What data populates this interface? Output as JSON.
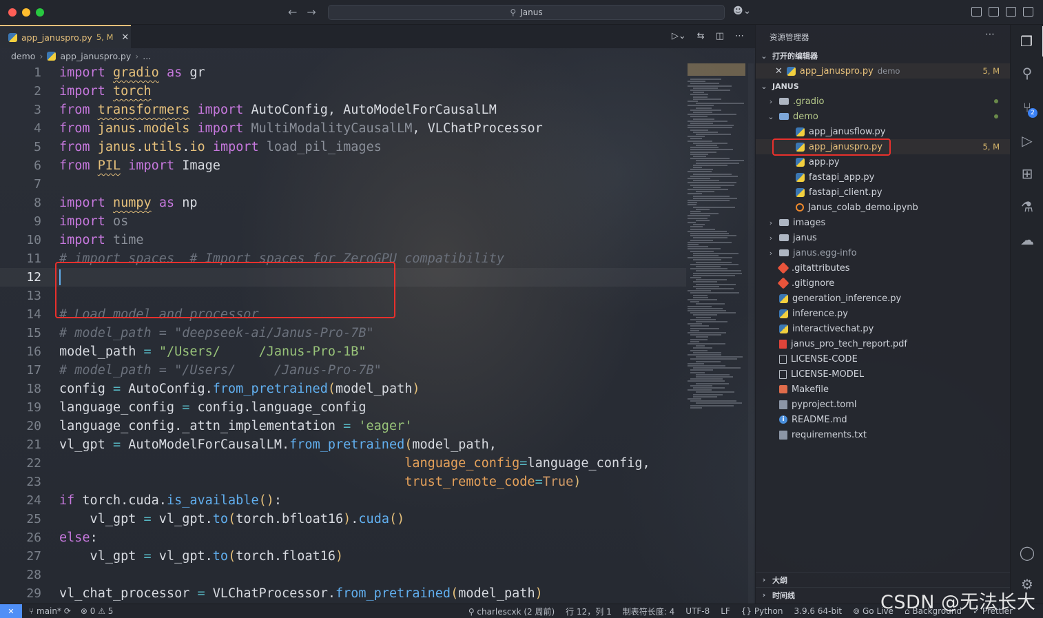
{
  "window": {
    "search_text": "Janus"
  },
  "tab": {
    "filename": "app_januspro.py",
    "status": "5, M"
  },
  "breadcrumb": [
    "demo",
    "app_januspro.py",
    "..."
  ],
  "code": [
    {
      "n": "1",
      "segs": [
        [
          "kw",
          "import"
        ],
        [
          "plain",
          " "
        ],
        [
          "mod-n",
          "gradio"
        ],
        [
          "plain",
          " "
        ],
        [
          "kw",
          "as"
        ],
        [
          "plain",
          " gr"
        ]
      ]
    },
    {
      "n": "2",
      "segs": [
        [
          "kw",
          "import"
        ],
        [
          "plain",
          " "
        ],
        [
          "mod-n",
          "torch"
        ]
      ]
    },
    {
      "n": "3",
      "segs": [
        [
          "kw",
          "from"
        ],
        [
          "plain",
          " "
        ],
        [
          "mod-n",
          "transformers"
        ],
        [
          "plain",
          " "
        ],
        [
          "kw",
          "import"
        ],
        [
          "plain",
          " AutoConfig, AutoModelForCausalLM"
        ]
      ]
    },
    {
      "n": "4",
      "segs": [
        [
          "kw",
          "from"
        ],
        [
          "plain",
          " "
        ],
        [
          "mod-p",
          "janus"
        ],
        [
          "plain",
          "."
        ],
        [
          "mod-p",
          "models"
        ],
        [
          "plain",
          " "
        ],
        [
          "kw",
          "import"
        ],
        [
          "dim",
          " MultiModalityCausalLM"
        ],
        [
          "plain",
          ", VLChatProcessor"
        ]
      ]
    },
    {
      "n": "5",
      "segs": [
        [
          "kw",
          "from"
        ],
        [
          "plain",
          " "
        ],
        [
          "mod-p",
          "janus"
        ],
        [
          "plain",
          "."
        ],
        [
          "mod-p",
          "utils"
        ],
        [
          "plain",
          "."
        ],
        [
          "mod-p",
          "io"
        ],
        [
          "plain",
          " "
        ],
        [
          "kw",
          "import"
        ],
        [
          "dim",
          " load_pil_images"
        ]
      ]
    },
    {
      "n": "6",
      "segs": [
        [
          "kw",
          "from"
        ],
        [
          "plain",
          " "
        ],
        [
          "mod-n",
          "PIL"
        ],
        [
          "plain",
          " "
        ],
        [
          "kw",
          "import"
        ],
        [
          "plain",
          " Image"
        ]
      ]
    },
    {
      "n": "7",
      "segs": []
    },
    {
      "n": "8",
      "segs": [
        [
          "kw",
          "import"
        ],
        [
          "plain",
          " "
        ],
        [
          "mod-n",
          "numpy"
        ],
        [
          "plain",
          " "
        ],
        [
          "kw",
          "as"
        ],
        [
          "plain",
          " np"
        ]
      ]
    },
    {
      "n": "9",
      "segs": [
        [
          "kw",
          "import"
        ],
        [
          "dim",
          " os"
        ]
      ]
    },
    {
      "n": "10",
      "segs": [
        [
          "kw",
          "import"
        ],
        [
          "dim",
          " time"
        ]
      ]
    },
    {
      "n": "11",
      "segs": [
        [
          "cmt",
          "# import spaces  # Import spaces for ZeroGPU compatibility"
        ]
      ]
    },
    {
      "n": "12",
      "segs": []
    },
    {
      "n": "13",
      "segs": []
    },
    {
      "n": "14",
      "segs": [
        [
          "cmt",
          "# Load model and processor"
        ]
      ]
    },
    {
      "n": "15",
      "segs": [
        [
          "cmt",
          "# model_path = \"deepseek-ai/Janus-Pro-7B\""
        ]
      ]
    },
    {
      "n": "16",
      "segs": [
        [
          "plain",
          "model_path "
        ],
        [
          "op",
          "="
        ],
        [
          "plain",
          " "
        ],
        [
          "str",
          "\"/Users/     /Janus-Pro-1B\""
        ]
      ]
    },
    {
      "n": "17",
      "segs": [
        [
          "cmt",
          "# model_path = \"/Users/     /Janus-Pro-7B\""
        ]
      ]
    },
    {
      "n": "18",
      "segs": [
        [
          "plain",
          "config "
        ],
        [
          "op",
          "="
        ],
        [
          "plain",
          " AutoConfig."
        ],
        [
          "fn",
          "from_pretrained"
        ],
        [
          "cls",
          "("
        ],
        [
          "plain",
          "model_path"
        ],
        [
          "cls",
          ")"
        ]
      ]
    },
    {
      "n": "19",
      "segs": [
        [
          "plain",
          "language_config "
        ],
        [
          "op",
          "="
        ],
        [
          "plain",
          " config.language_config"
        ]
      ]
    },
    {
      "n": "20",
      "segs": [
        [
          "plain",
          "language_config._attn_implementation "
        ],
        [
          "op",
          "="
        ],
        [
          "plain",
          " "
        ],
        [
          "str",
          "'eager'"
        ]
      ]
    },
    {
      "n": "21",
      "segs": [
        [
          "plain",
          "vl_gpt "
        ],
        [
          "op",
          "="
        ],
        [
          "plain",
          " AutoModelForCausalLM."
        ],
        [
          "fn",
          "from_pretrained"
        ],
        [
          "cls",
          "("
        ],
        [
          "plain",
          "model_path,"
        ]
      ]
    },
    {
      "n": "22",
      "segs": [
        [
          "plain",
          "                                             "
        ],
        [
          "arg",
          "language_config"
        ],
        [
          "op",
          "="
        ],
        [
          "plain",
          "language_config,"
        ]
      ]
    },
    {
      "n": "23",
      "segs": [
        [
          "plain",
          "                                             "
        ],
        [
          "arg",
          "trust_remote_code"
        ],
        [
          "op",
          "="
        ],
        [
          "num",
          "True"
        ],
        [
          "cls",
          ")"
        ]
      ]
    },
    {
      "n": "24",
      "segs": [
        [
          "kw",
          "if"
        ],
        [
          "plain",
          " torch.cuda."
        ],
        [
          "fn",
          "is_available"
        ],
        [
          "cls",
          "()"
        ],
        [
          "plain",
          ":"
        ]
      ]
    },
    {
      "n": "25",
      "segs": [
        [
          "plain",
          "    vl_gpt "
        ],
        [
          "op",
          "="
        ],
        [
          "plain",
          " vl_gpt."
        ],
        [
          "fn",
          "to"
        ],
        [
          "cls",
          "("
        ],
        [
          "plain",
          "torch.bfloat16"
        ],
        [
          "cls",
          ")"
        ],
        [
          "plain",
          "."
        ],
        [
          "fn",
          "cuda"
        ],
        [
          "cls",
          "()"
        ]
      ]
    },
    {
      "n": "26",
      "segs": [
        [
          "kw",
          "else"
        ],
        [
          "plain",
          ":"
        ]
      ]
    },
    {
      "n": "27",
      "segs": [
        [
          "plain",
          "    vl_gpt "
        ],
        [
          "op",
          "="
        ],
        [
          "plain",
          " vl_gpt."
        ],
        [
          "fn",
          "to"
        ],
        [
          "cls",
          "("
        ],
        [
          "plain",
          "torch.float16"
        ],
        [
          "cls",
          ")"
        ]
      ]
    },
    {
      "n": "28",
      "segs": []
    },
    {
      "n": "29",
      "segs": [
        [
          "plain",
          "vl_chat_processor "
        ],
        [
          "op",
          "="
        ],
        [
          "plain",
          " VLChatProcessor."
        ],
        [
          "fn",
          "from_pretrained"
        ],
        [
          "cls",
          "("
        ],
        [
          "plain",
          "model_path"
        ],
        [
          "cls",
          ")"
        ]
      ]
    }
  ],
  "explorer": {
    "title": "资源管理器",
    "open_editors_label": "打开的编辑器",
    "open_editor": {
      "name": "app_januspro.py",
      "folder": "demo",
      "status": "5, M"
    },
    "project_label": "JANUS",
    "tree": [
      {
        "name": ".gradio",
        "type": "folder",
        "indent": 1,
        "chev": "›",
        "dot": true
      },
      {
        "name": "demo",
        "type": "folder-open",
        "indent": 1,
        "chev": "⌄",
        "dot": true
      },
      {
        "name": "app_janusflow.py",
        "type": "py",
        "indent": 2
      },
      {
        "name": "app_januspro.py",
        "type": "py",
        "indent": 2,
        "status": "5, M",
        "selected": true
      },
      {
        "name": "app.py",
        "type": "py",
        "indent": 2
      },
      {
        "name": "fastapi_app.py",
        "type": "py",
        "indent": 2
      },
      {
        "name": "fastapi_client.py",
        "type": "py",
        "indent": 2
      },
      {
        "name": "Janus_colab_demo.ipynb",
        "type": "nb",
        "indent": 2
      },
      {
        "name": "images",
        "type": "folder",
        "indent": 1,
        "chev": "›"
      },
      {
        "name": "janus",
        "type": "folder",
        "indent": 1,
        "chev": "›"
      },
      {
        "name": "janus.egg-info",
        "type": "folder",
        "indent": 1,
        "chev": "›"
      },
      {
        "name": ".gitattributes",
        "type": "git",
        "indent": 1
      },
      {
        "name": ".gitignore",
        "type": "git",
        "indent": 1
      },
      {
        "name": "generation_inference.py",
        "type": "py",
        "indent": 1
      },
      {
        "name": "inference.py",
        "type": "py",
        "indent": 1
      },
      {
        "name": "interactivechat.py",
        "type": "py",
        "indent": 1
      },
      {
        "name": "janus_pro_tech_report.pdf",
        "type": "pdf",
        "indent": 1
      },
      {
        "name": "LICENSE-CODE",
        "type": "doc",
        "indent": 1
      },
      {
        "name": "LICENSE-MODEL",
        "type": "doc",
        "indent": 1
      },
      {
        "name": "Makefile",
        "type": "make",
        "indent": 1
      },
      {
        "name": "pyproject.toml",
        "type": "toml",
        "indent": 1
      },
      {
        "name": "README.md",
        "type": "info",
        "indent": 1
      },
      {
        "name": "requirements.txt",
        "type": "toml",
        "indent": 1
      }
    ],
    "outline_label": "大纲",
    "timeline_label": "时间线"
  },
  "activity": {
    "scm_badge": "2"
  },
  "status": {
    "branch": "main*",
    "errors": "0",
    "warnings": "5",
    "author": "charlescxk (2 周前)",
    "position": "行 12，列 1",
    "indent": "制表符长度: 4",
    "encoding": "UTF-8",
    "eol": "LF",
    "language": "Python",
    "interpreter": "3.9.6 64-bit",
    "golive": "Go Live",
    "background": "Background",
    "prettier": "Prettier"
  },
  "watermark": "CSDN @无法长大"
}
